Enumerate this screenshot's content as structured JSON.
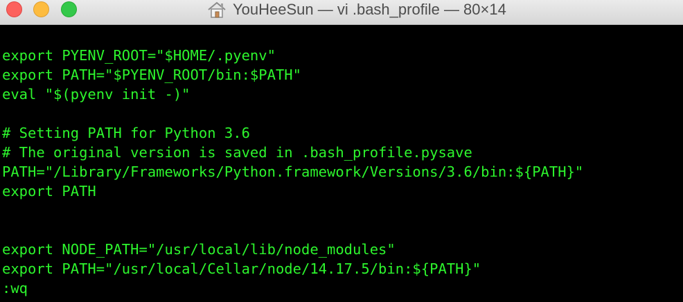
{
  "window": {
    "title": "YouHeeSun — vi .bash_profile — 80×14",
    "icon": "house-icon"
  },
  "colors": {
    "text": "#2df52d",
    "background": "#000000",
    "close": "#fc615d",
    "minimize": "#fdbc40",
    "maximize": "#34c84a"
  },
  "editor": {
    "lines": [
      "export PYENV_ROOT=\"$HOME/.pyenv\"",
      "export PATH=\"$PYENV_ROOT/bin:$PATH\"",
      "eval \"$(pyenv init -)\"",
      "",
      "# Setting PATH for Python 3.6",
      "# The original version is saved in .bash_profile.pysave",
      "PATH=\"/Library/Frameworks/Python.framework/Versions/3.6/bin:${PATH}\"",
      "export PATH",
      "",
      "",
      "export NODE_PATH=\"/usr/local/lib/node_modules\"",
      "export PATH=\"/usr/local/Cellar/node/14.17.5/bin:${PATH}\"",
      ":wq"
    ]
  }
}
